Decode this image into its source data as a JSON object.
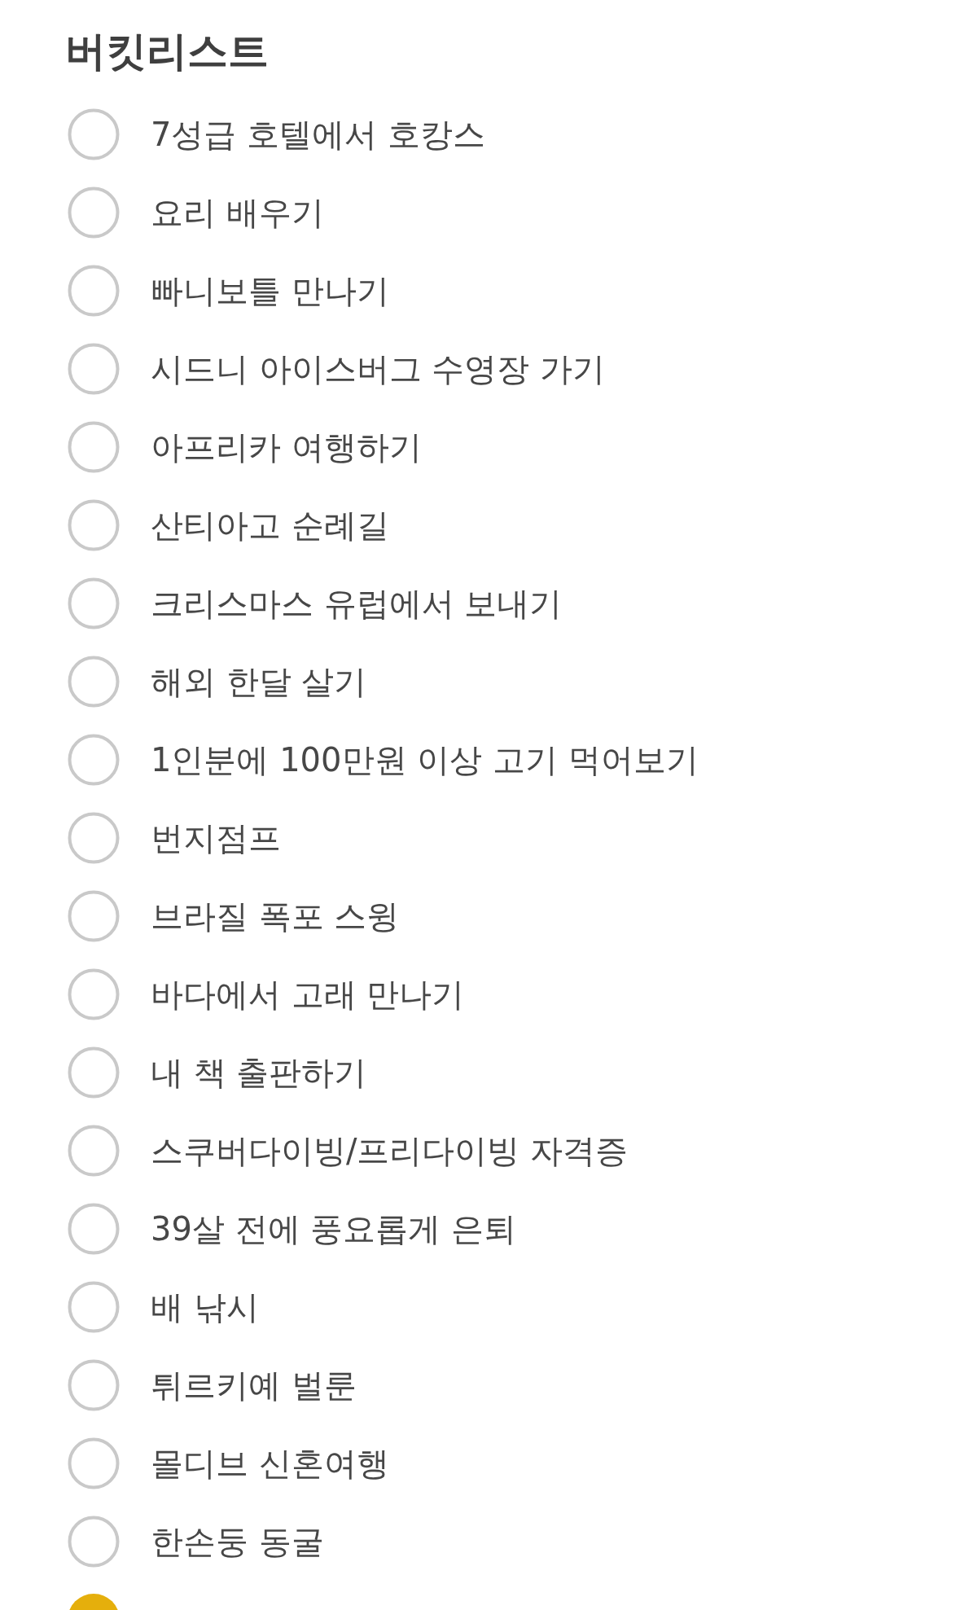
{
  "title": "버킷리스트",
  "items": [
    {
      "text": "7성급 호텔에서 호캉스",
      "checked": false
    },
    {
      "text": "요리 배우기",
      "checked": false
    },
    {
      "text": "빠니보틀 만나기",
      "checked": false
    },
    {
      "text": "시드니 아이스버그 수영장 가기",
      "checked": false
    },
    {
      "text": "아프리카 여행하기",
      "checked": false
    },
    {
      "text": "산티아고 순례길",
      "checked": false
    },
    {
      "text": "크리스마스 유럽에서 보내기",
      "checked": false
    },
    {
      "text": "해외 한달 살기",
      "checked": false
    },
    {
      "text": "1인분에 100만원 이상 고기 먹어보기",
      "checked": false
    },
    {
      "text": "번지점프",
      "checked": false
    },
    {
      "text": "브라질 폭포 스윙",
      "checked": false
    },
    {
      "text": "바다에서 고래 만나기",
      "checked": false
    },
    {
      "text": "내 책 출판하기",
      "checked": false
    },
    {
      "text": "스쿠버다이빙/프리다이빙 자격증",
      "checked": false
    },
    {
      "text": "39살 전에 풍요롭게 은퇴",
      "checked": false
    },
    {
      "text": "배 낚시",
      "checked": false
    },
    {
      "text": "튀르키예 벌룬",
      "checked": false
    },
    {
      "text": "몰디브 신혼여행",
      "checked": false
    },
    {
      "text": "한손둥 동굴",
      "checked": false
    },
    {
      "checked": true
    }
  ]
}
